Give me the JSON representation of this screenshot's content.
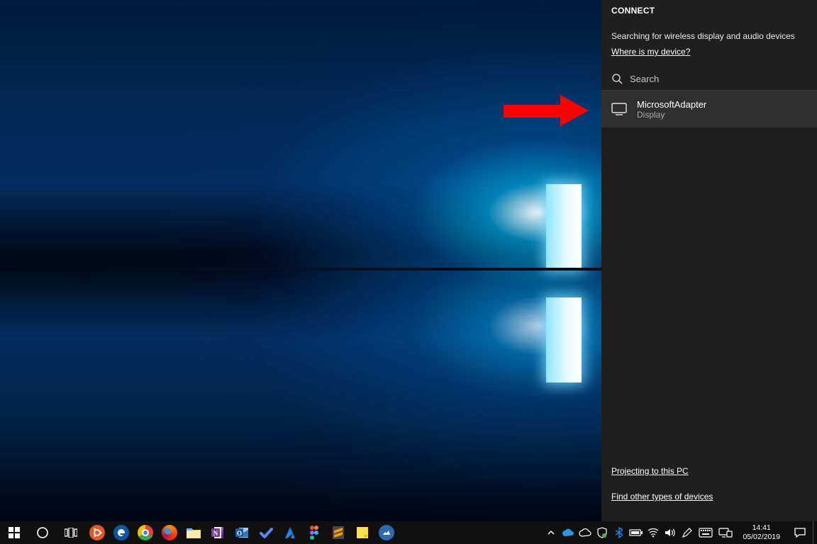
{
  "connect": {
    "title": "CONNECT",
    "status": "Searching for wireless display and audio devices",
    "where_link": "Where is my device?",
    "search_placeholder": "Search",
    "device": {
      "name": "MicrosoftAdapter",
      "type": "Display"
    },
    "projecting_link": "Projecting to this PC",
    "other_devices_link": "Find other types of devices"
  },
  "taskbar": {
    "clock": {
      "time": "14:41",
      "date": "05/02/2019"
    },
    "pinned": [
      {
        "id": "ubuntu",
        "name": "ubuntu-icon"
      },
      {
        "id": "edge",
        "name": "edge-icon"
      },
      {
        "id": "chrome",
        "name": "chrome-icon"
      },
      {
        "id": "firefox",
        "name": "firefox-icon"
      },
      {
        "id": "file-explorer",
        "name": "file-explorer-icon"
      },
      {
        "id": "onenote",
        "name": "onenote-icon"
      },
      {
        "id": "outlook",
        "name": "outlook-icon"
      },
      {
        "id": "todo",
        "name": "todo-icon"
      },
      {
        "id": "azure",
        "name": "azure-icon"
      },
      {
        "id": "figma",
        "name": "figma-icon"
      },
      {
        "id": "sublime",
        "name": "sublime-icon"
      },
      {
        "id": "stickies",
        "name": "sticky-notes-icon"
      },
      {
        "id": "photos",
        "name": "photos-icon"
      }
    ],
    "tray": [
      {
        "id": "overflow",
        "name": "tray-overflow-icon"
      },
      {
        "id": "onedrive-blue",
        "name": "onedrive-personal-icon"
      },
      {
        "id": "onedrive-white",
        "name": "onedrive-business-icon"
      },
      {
        "id": "defender",
        "name": "windows-security-icon"
      },
      {
        "id": "bluetooth",
        "name": "bluetooth-icon"
      },
      {
        "id": "battery",
        "name": "battery-icon"
      },
      {
        "id": "wifi",
        "name": "wifi-icon"
      },
      {
        "id": "volume",
        "name": "volume-icon"
      },
      {
        "id": "pen",
        "name": "pen-icon"
      },
      {
        "id": "keyboard",
        "name": "touch-keyboard-icon"
      },
      {
        "id": "project",
        "name": "project-icon"
      }
    ]
  }
}
